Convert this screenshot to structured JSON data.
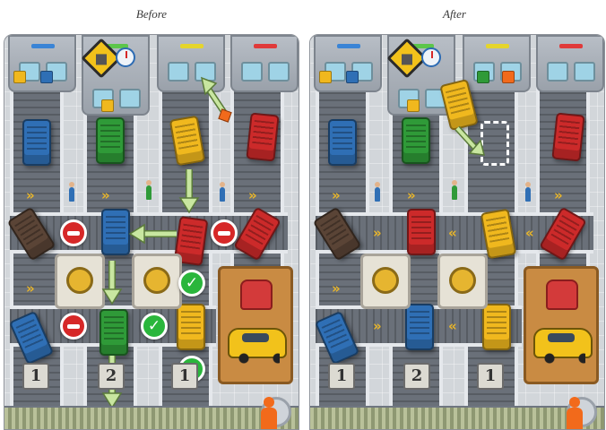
{
  "panels": [
    {
      "label": "Before"
    },
    {
      "label": "After"
    }
  ],
  "colors": {
    "blue": "#2f6fb5",
    "green": "#2f9a38",
    "yellow": "#f0b81e",
    "red": "#cc2a2a",
    "brown": "#5a4436",
    "orange": "#f26a1b",
    "check_green": "#2ab63c",
    "no_entry_red": "#d62828"
  },
  "board": {
    "dock_flags": [
      "yellow",
      "blue",
      "",
      "green",
      "red"
    ],
    "lane_numbers": [
      "1",
      "2",
      "1"
    ],
    "reward": {
      "icons": [
        "seat-icon",
        "car-icon"
      ]
    },
    "hub_icons": [
      "package-hub-icon",
      "timer-icon"
    ]
  },
  "before": {
    "trucks": [
      "blue",
      "green",
      "yellow",
      "red",
      "brown",
      "blue",
      "red",
      "red",
      "blue",
      "green",
      "yellow"
    ],
    "markers": [
      "no-entry",
      "no-entry",
      "no-entry",
      "check",
      "check",
      "check"
    ],
    "arrows": [
      "up-right",
      "down",
      "left",
      "down",
      "down"
    ]
  },
  "after": {
    "trucks": [
      "blue",
      "green",
      "yellow",
      "red",
      "brown",
      "red",
      "yellow",
      "red",
      "blue",
      "blue",
      "yellow"
    ],
    "arrows": [
      "down-right"
    ]
  }
}
